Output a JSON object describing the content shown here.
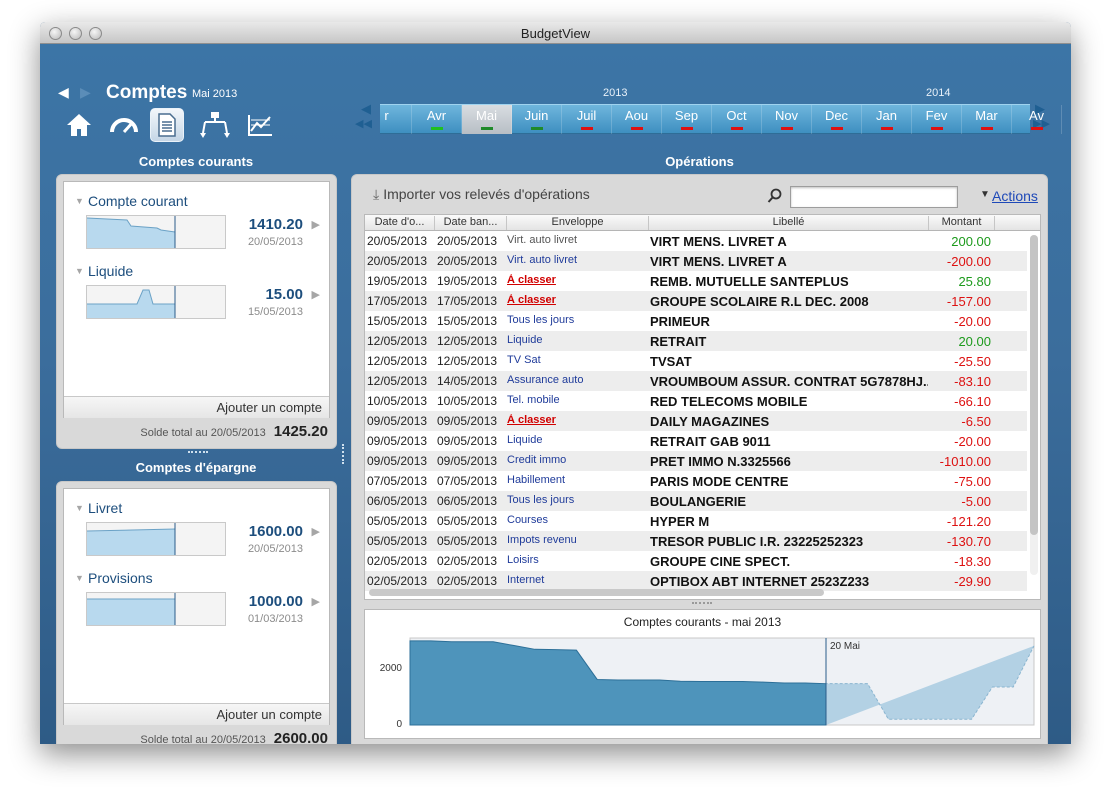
{
  "window": {
    "title": "BudgetView"
  },
  "header": {
    "title": "Comptes",
    "subtitle": "Mai 2013"
  },
  "modes": [
    {
      "icon": "home-icon",
      "active": false
    },
    {
      "icon": "gauge-icon",
      "active": false
    },
    {
      "icon": "document-icon",
      "active": true
    },
    {
      "icon": "categories-icon",
      "active": false
    },
    {
      "icon": "chart-icon",
      "active": false
    }
  ],
  "timeline": {
    "years": [
      "2013",
      "2014"
    ],
    "months": [
      {
        "label": "r",
        "bar": "none"
      },
      {
        "label": "Avr",
        "bar": "#20c020"
      },
      {
        "label": "Mai",
        "bar": "#1f8a2a",
        "selected": true
      },
      {
        "label": "Juin",
        "bar": "#1f8a2a"
      },
      {
        "label": "Juil",
        "bar": "#e01010"
      },
      {
        "label": "Aou",
        "bar": "#e01010"
      },
      {
        "label": "Sep",
        "bar": "#e01010"
      },
      {
        "label": "Oct",
        "bar": "#e01010"
      },
      {
        "label": "Nov",
        "bar": "#e01010"
      },
      {
        "label": "Dec",
        "bar": "#e01010"
      },
      {
        "label": "Jan",
        "bar": "#e01010"
      },
      {
        "label": "Fev",
        "bar": "#e01010"
      },
      {
        "label": "Mar",
        "bar": "#e01010"
      },
      {
        "label": "Av",
        "bar": "#e01010"
      }
    ]
  },
  "comptes_courants": {
    "title": "Comptes courants",
    "accounts": [
      {
        "name": "Compte courant",
        "amount": "1410.20",
        "date": "20/05/2013"
      },
      {
        "name": "Liquide",
        "amount": "15.00",
        "date": "15/05/2013"
      }
    ],
    "add_label": "Ajouter un compte",
    "total_label": "Solde total  au 20/05/2013",
    "total_value": "1425.20"
  },
  "comptes_epargne": {
    "title": "Comptes d'épargne",
    "accounts": [
      {
        "name": "Livret",
        "amount": "1600.00",
        "date": "20/05/2013"
      },
      {
        "name": "Provisions",
        "amount": "1000.00",
        "date": "01/03/2013"
      }
    ],
    "add_label": "Ajouter un compte",
    "total_label": "Solde total  au 20/05/2013",
    "total_value": "2600.00"
  },
  "operations": {
    "title": "Opérations",
    "import_label": "Importer vos relevés d'opérations",
    "search_value": "",
    "actions_label": "Actions",
    "columns": [
      "Date d'o...",
      "Date ban...",
      "Enveloppe",
      "Libellé",
      "Montant"
    ],
    "rows": [
      {
        "d1": "20/05/2013",
        "d2": "20/05/2013",
        "env": "Virt. auto livret",
        "env_gray": true,
        "lib": "VIRT MENS. LIVRET A",
        "amt": "200.00",
        "pos": true
      },
      {
        "d1": "20/05/2013",
        "d2": "20/05/2013",
        "env": "Virt. auto livret",
        "lib": "VIRT MENS. LIVRET A",
        "amt": "-200.00"
      },
      {
        "d1": "19/05/2013",
        "d2": "19/05/2013",
        "env": "À classer",
        "env_red": true,
        "lib": "REMB. MUTUELLE SANTEPLUS",
        "amt": "25.80",
        "pos": true
      },
      {
        "d1": "17/05/2013",
        "d2": "17/05/2013",
        "env": "À classer",
        "env_red": true,
        "lib": "GROUPE SCOLAIRE R.L DEC. 2008",
        "amt": "-157.00"
      },
      {
        "d1": "15/05/2013",
        "d2": "15/05/2013",
        "env": "Tous les jours",
        "lib": "PRIMEUR",
        "amt": "-20.00"
      },
      {
        "d1": "12/05/2013",
        "d2": "12/05/2013",
        "env": "Liquide",
        "lib": "RETRAIT",
        "amt": "20.00",
        "pos": true
      },
      {
        "d1": "12/05/2013",
        "d2": "12/05/2013",
        "env": "TV Sat",
        "lib": "TVSAT",
        "amt": "-25.50"
      },
      {
        "d1": "12/05/2013",
        "d2": "14/05/2013",
        "env": "Assurance auto",
        "lib": "VROUMBOUM ASSUR. CONTRAT 5G7878HJ...",
        "amt": "-83.10"
      },
      {
        "d1": "10/05/2013",
        "d2": "10/05/2013",
        "env": "Tel. mobile",
        "lib": "RED TELECOMS MOBILE",
        "amt": "-66.10"
      },
      {
        "d1": "09/05/2013",
        "d2": "09/05/2013",
        "env": "À classer",
        "env_red": true,
        "lib": "DAILY MAGAZINES",
        "amt": "-6.50"
      },
      {
        "d1": "09/05/2013",
        "d2": "09/05/2013",
        "env": "Liquide",
        "lib": "RETRAIT GAB 9011",
        "amt": "-20.00"
      },
      {
        "d1": "09/05/2013",
        "d2": "09/05/2013",
        "env": "Credit immo",
        "lib": "PRET IMMO N.3325566",
        "amt": "-1010.00"
      },
      {
        "d1": "07/05/2013",
        "d2": "07/05/2013",
        "env": "Habillement",
        "lib": "PARIS MODE CENTRE",
        "amt": "-75.00"
      },
      {
        "d1": "06/05/2013",
        "d2": "06/05/2013",
        "env": "Tous les jours",
        "lib": "BOULANGERIE",
        "amt": "-5.00"
      },
      {
        "d1": "05/05/2013",
        "d2": "05/05/2013",
        "env": "Courses",
        "lib": "HYPER M",
        "amt": "-121.20"
      },
      {
        "d1": "05/05/2013",
        "d2": "05/05/2013",
        "env": "Impots revenu",
        "lib": "TRESOR PUBLIC I.R. 23225252323",
        "amt": "-130.70"
      },
      {
        "d1": "02/05/2013",
        "d2": "02/05/2013",
        "env": "Loisirs",
        "lib": "GROUPE CINE SPECT.",
        "amt": "-18.30"
      },
      {
        "d1": "02/05/2013",
        "d2": "02/05/2013",
        "env": "Internet",
        "lib": "OPTIBOX ABT INTERNET 2523Z233",
        "amt": "-29.90"
      }
    ]
  },
  "chart_data": {
    "type": "area",
    "title": "Comptes courants - mai 2013",
    "marker_label": "20 Mai",
    "y_ticks": [
      "2000",
      "0"
    ],
    "ylim": [
      0,
      3000
    ],
    "x_days": [
      1,
      2,
      3,
      4,
      5,
      6,
      7,
      8,
      9,
      10,
      11,
      12,
      13,
      14,
      15,
      16,
      17,
      18,
      19,
      20,
      21,
      22,
      23,
      24,
      25,
      26,
      27,
      28,
      29,
      30,
      31
    ],
    "actual": [
      2900,
      2900,
      2870,
      2870,
      2870,
      2740,
      2610,
      2600,
      2580,
      1570,
      1550,
      1550,
      1550,
      1510,
      1500,
      1500,
      1500,
      1480,
      1450,
      1450,
      1425
    ],
    "forecast": [
      1425,
      1425,
      1425,
      200,
      200,
      200,
      200,
      200,
      1310,
      1310,
      2730,
      2730,
      2730,
      2730,
      2730,
      2730,
      2730,
      2730,
      2730,
      2730,
      2730
    ],
    "colors": {
      "actual": "#4e94bb",
      "forecast": "#b3d1e4"
    }
  }
}
